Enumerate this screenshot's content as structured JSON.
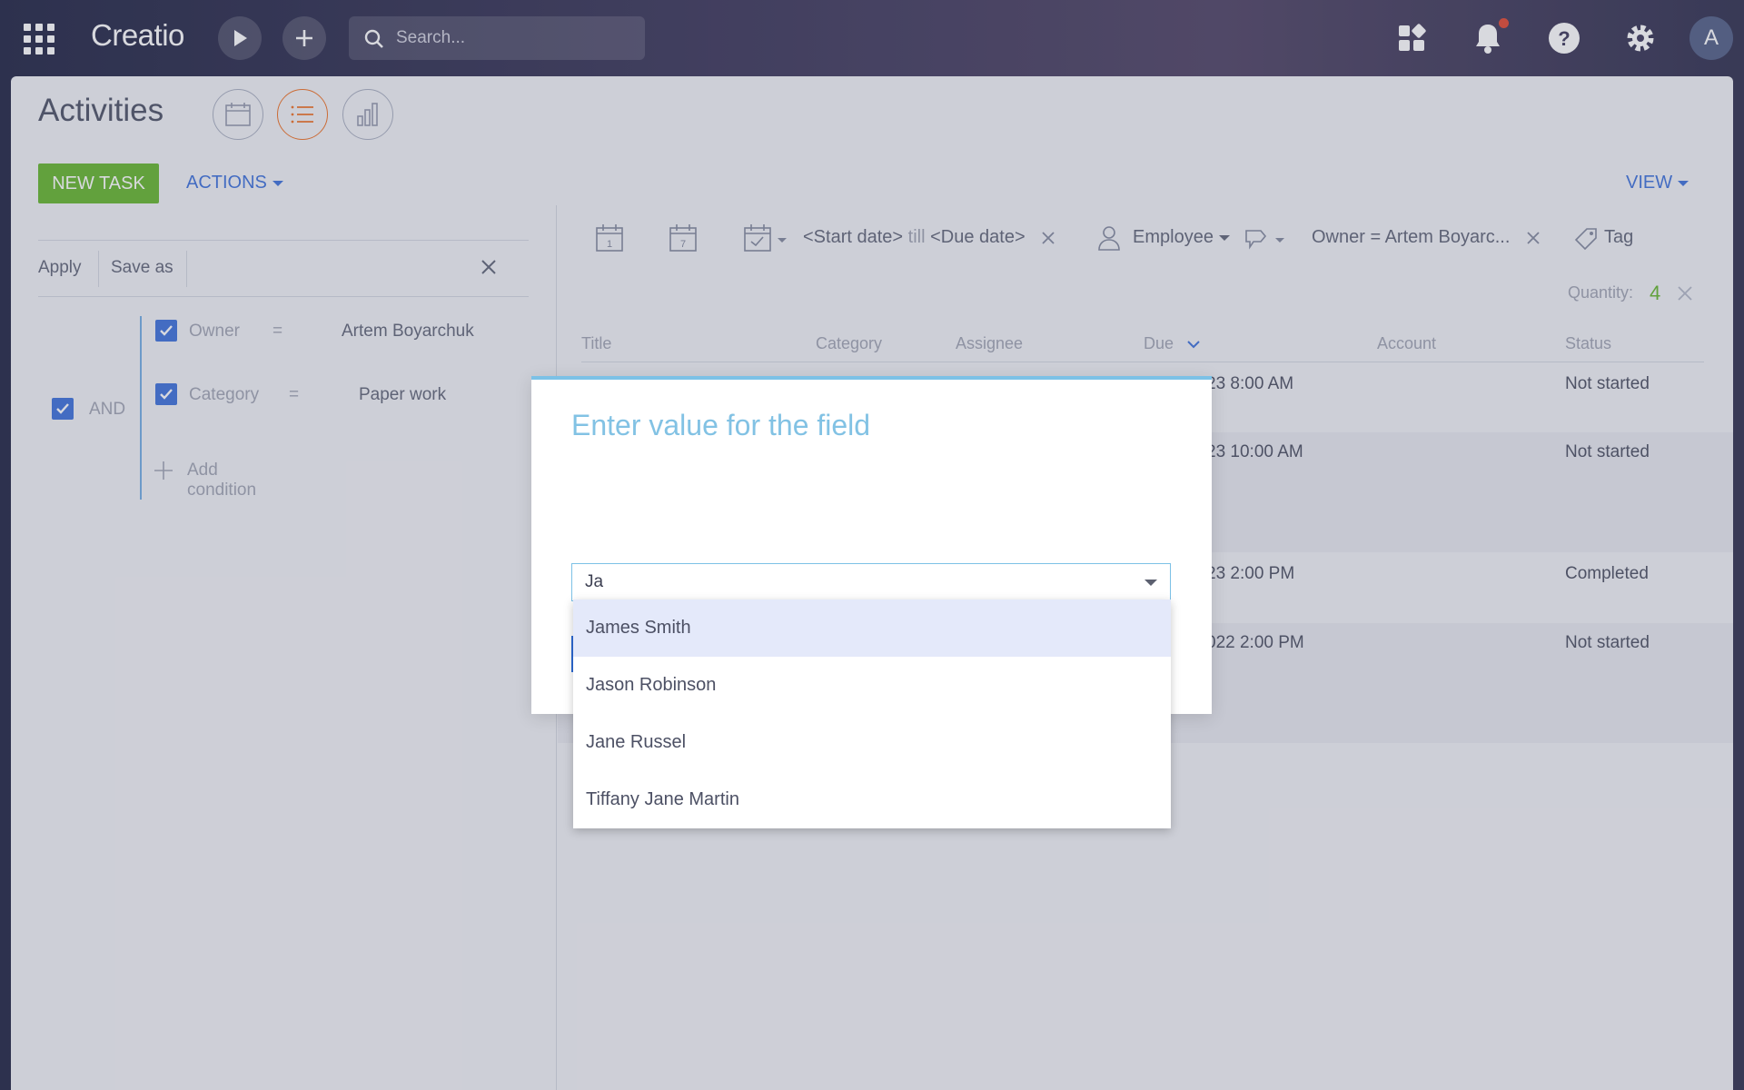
{
  "topbar": {
    "logo": "Creatio",
    "search_placeholder": "Search...",
    "avatar_initial": "A"
  },
  "page": {
    "title": "Activities",
    "new_task_label": "NEW TASK",
    "actions_label": "ACTIONS",
    "view_label": "VIEW"
  },
  "filter": {
    "apply_label": "Apply",
    "save_as_label": "Save as",
    "group_operator": "AND",
    "conditions": [
      {
        "field": "Owner",
        "op": "=",
        "value": "Artem Boyarchuk"
      },
      {
        "field": "Category",
        "op": "=",
        "value": "Paper work"
      }
    ],
    "add_condition_label": "Add condition"
  },
  "toolbar": {
    "start_date": "<Start date>",
    "till": "till",
    "due_date": "<Due date>",
    "employee_label": "Employee",
    "owner_filter": "Owner = Artem Boyarc...",
    "tag_label": "Tag",
    "quantity_label": "Quantity:",
    "quantity_value": "4"
  },
  "grid": {
    "columns": [
      "Title",
      "Category",
      "Assignee",
      "Due",
      "Account",
      "Status"
    ],
    "rows": [
      {
        "due": "23 8:00 AM",
        "status": "Not started"
      },
      {
        "due": "23 10:00 AM",
        "status": "Not started"
      },
      {
        "due": "23 2:00 PM",
        "status": "Completed"
      },
      {
        "due": "022 2:00 PM",
        "status": "Not started"
      }
    ]
  },
  "modal": {
    "title": "Enter value for the field",
    "input_value": "Ja",
    "options": [
      "James Smith",
      "Jason Robinson",
      "Jane Russel",
      "Tiffany Jane Martin"
    ],
    "selected_index": 0
  },
  "colors": {
    "accent_blue": "#4a7bdd",
    "new_task_green": "#6fbb3b",
    "modal_title": "#82c2e4",
    "quantity_green": "#6fbb3b",
    "active_view_orange": "#f07b34"
  }
}
